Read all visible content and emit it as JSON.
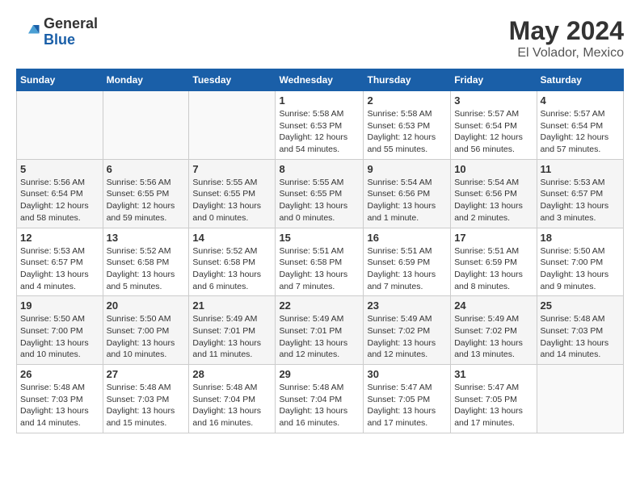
{
  "header": {
    "logo_general": "General",
    "logo_blue": "Blue",
    "title": "May 2024",
    "subtitle": "El Volador, Mexico"
  },
  "days_of_week": [
    "Sunday",
    "Monday",
    "Tuesday",
    "Wednesday",
    "Thursday",
    "Friday",
    "Saturday"
  ],
  "weeks": [
    [
      {
        "day": "",
        "info": ""
      },
      {
        "day": "",
        "info": ""
      },
      {
        "day": "",
        "info": ""
      },
      {
        "day": "1",
        "info": "Sunrise: 5:58 AM\nSunset: 6:53 PM\nDaylight: 12 hours\nand 54 minutes."
      },
      {
        "day": "2",
        "info": "Sunrise: 5:58 AM\nSunset: 6:53 PM\nDaylight: 12 hours\nand 55 minutes."
      },
      {
        "day": "3",
        "info": "Sunrise: 5:57 AM\nSunset: 6:54 PM\nDaylight: 12 hours\nand 56 minutes."
      },
      {
        "day": "4",
        "info": "Sunrise: 5:57 AM\nSunset: 6:54 PM\nDaylight: 12 hours\nand 57 minutes."
      }
    ],
    [
      {
        "day": "5",
        "info": "Sunrise: 5:56 AM\nSunset: 6:54 PM\nDaylight: 12 hours\nand 58 minutes."
      },
      {
        "day": "6",
        "info": "Sunrise: 5:56 AM\nSunset: 6:55 PM\nDaylight: 12 hours\nand 59 minutes."
      },
      {
        "day": "7",
        "info": "Sunrise: 5:55 AM\nSunset: 6:55 PM\nDaylight: 13 hours\nand 0 minutes."
      },
      {
        "day": "8",
        "info": "Sunrise: 5:55 AM\nSunset: 6:55 PM\nDaylight: 13 hours\nand 0 minutes."
      },
      {
        "day": "9",
        "info": "Sunrise: 5:54 AM\nSunset: 6:56 PM\nDaylight: 13 hours\nand 1 minute."
      },
      {
        "day": "10",
        "info": "Sunrise: 5:54 AM\nSunset: 6:56 PM\nDaylight: 13 hours\nand 2 minutes."
      },
      {
        "day": "11",
        "info": "Sunrise: 5:53 AM\nSunset: 6:57 PM\nDaylight: 13 hours\nand 3 minutes."
      }
    ],
    [
      {
        "day": "12",
        "info": "Sunrise: 5:53 AM\nSunset: 6:57 PM\nDaylight: 13 hours\nand 4 minutes."
      },
      {
        "day": "13",
        "info": "Sunrise: 5:52 AM\nSunset: 6:58 PM\nDaylight: 13 hours\nand 5 minutes."
      },
      {
        "day": "14",
        "info": "Sunrise: 5:52 AM\nSunset: 6:58 PM\nDaylight: 13 hours\nand 6 minutes."
      },
      {
        "day": "15",
        "info": "Sunrise: 5:51 AM\nSunset: 6:58 PM\nDaylight: 13 hours\nand 7 minutes."
      },
      {
        "day": "16",
        "info": "Sunrise: 5:51 AM\nSunset: 6:59 PM\nDaylight: 13 hours\nand 7 minutes."
      },
      {
        "day": "17",
        "info": "Sunrise: 5:51 AM\nSunset: 6:59 PM\nDaylight: 13 hours\nand 8 minutes."
      },
      {
        "day": "18",
        "info": "Sunrise: 5:50 AM\nSunset: 7:00 PM\nDaylight: 13 hours\nand 9 minutes."
      }
    ],
    [
      {
        "day": "19",
        "info": "Sunrise: 5:50 AM\nSunset: 7:00 PM\nDaylight: 13 hours\nand 10 minutes."
      },
      {
        "day": "20",
        "info": "Sunrise: 5:50 AM\nSunset: 7:00 PM\nDaylight: 13 hours\nand 10 minutes."
      },
      {
        "day": "21",
        "info": "Sunrise: 5:49 AM\nSunset: 7:01 PM\nDaylight: 13 hours\nand 11 minutes."
      },
      {
        "day": "22",
        "info": "Sunrise: 5:49 AM\nSunset: 7:01 PM\nDaylight: 13 hours\nand 12 minutes."
      },
      {
        "day": "23",
        "info": "Sunrise: 5:49 AM\nSunset: 7:02 PM\nDaylight: 13 hours\nand 12 minutes."
      },
      {
        "day": "24",
        "info": "Sunrise: 5:49 AM\nSunset: 7:02 PM\nDaylight: 13 hours\nand 13 minutes."
      },
      {
        "day": "25",
        "info": "Sunrise: 5:48 AM\nSunset: 7:03 PM\nDaylight: 13 hours\nand 14 minutes."
      }
    ],
    [
      {
        "day": "26",
        "info": "Sunrise: 5:48 AM\nSunset: 7:03 PM\nDaylight: 13 hours\nand 14 minutes."
      },
      {
        "day": "27",
        "info": "Sunrise: 5:48 AM\nSunset: 7:03 PM\nDaylight: 13 hours\nand 15 minutes."
      },
      {
        "day": "28",
        "info": "Sunrise: 5:48 AM\nSunset: 7:04 PM\nDaylight: 13 hours\nand 16 minutes."
      },
      {
        "day": "29",
        "info": "Sunrise: 5:48 AM\nSunset: 7:04 PM\nDaylight: 13 hours\nand 16 minutes."
      },
      {
        "day": "30",
        "info": "Sunrise: 5:47 AM\nSunset: 7:05 PM\nDaylight: 13 hours\nand 17 minutes."
      },
      {
        "day": "31",
        "info": "Sunrise: 5:47 AM\nSunset: 7:05 PM\nDaylight: 13 hours\nand 17 minutes."
      },
      {
        "day": "",
        "info": ""
      }
    ]
  ]
}
